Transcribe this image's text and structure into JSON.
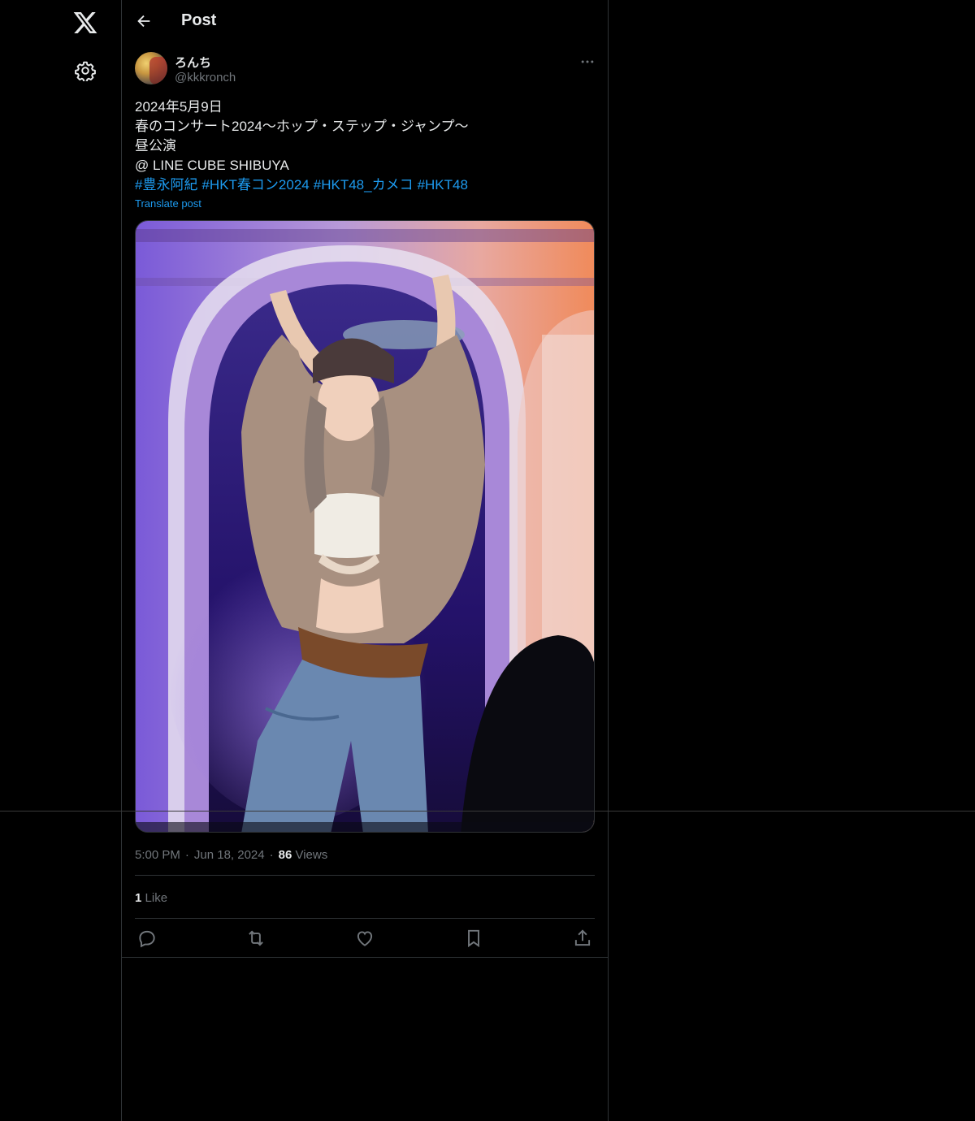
{
  "header": {
    "title": "Post"
  },
  "nav": {
    "logo_icon": "x-logo-icon",
    "settings_icon": "gear-icon"
  },
  "post": {
    "author": {
      "display_name": "ろんち",
      "handle": "@kkkronch"
    },
    "text_lines": [
      "2024年5月9日",
      "春のコンサート2024〜ホップ・ステップ・ジャンプ〜",
      "昼公演",
      "@ LINE CUBE SHIBUYA"
    ],
    "hashtags": [
      "#豊永阿紀",
      "#HKT春コン2024",
      "#HKT48_カメコ",
      "#HKT48"
    ],
    "translate_label": "Translate post",
    "time": "5:00 PM",
    "date": "Jun 18, 2024",
    "views_count": "86",
    "views_label": "Views",
    "likes_count": "1",
    "likes_label": "Like",
    "actions": [
      "reply-icon",
      "repost-icon",
      "like-icon",
      "bookmark-icon",
      "share-icon"
    ]
  },
  "colors": {
    "accent": "#1d9bf0",
    "background": "#000000",
    "border": "#2f3336",
    "muted": "#71767b"
  }
}
